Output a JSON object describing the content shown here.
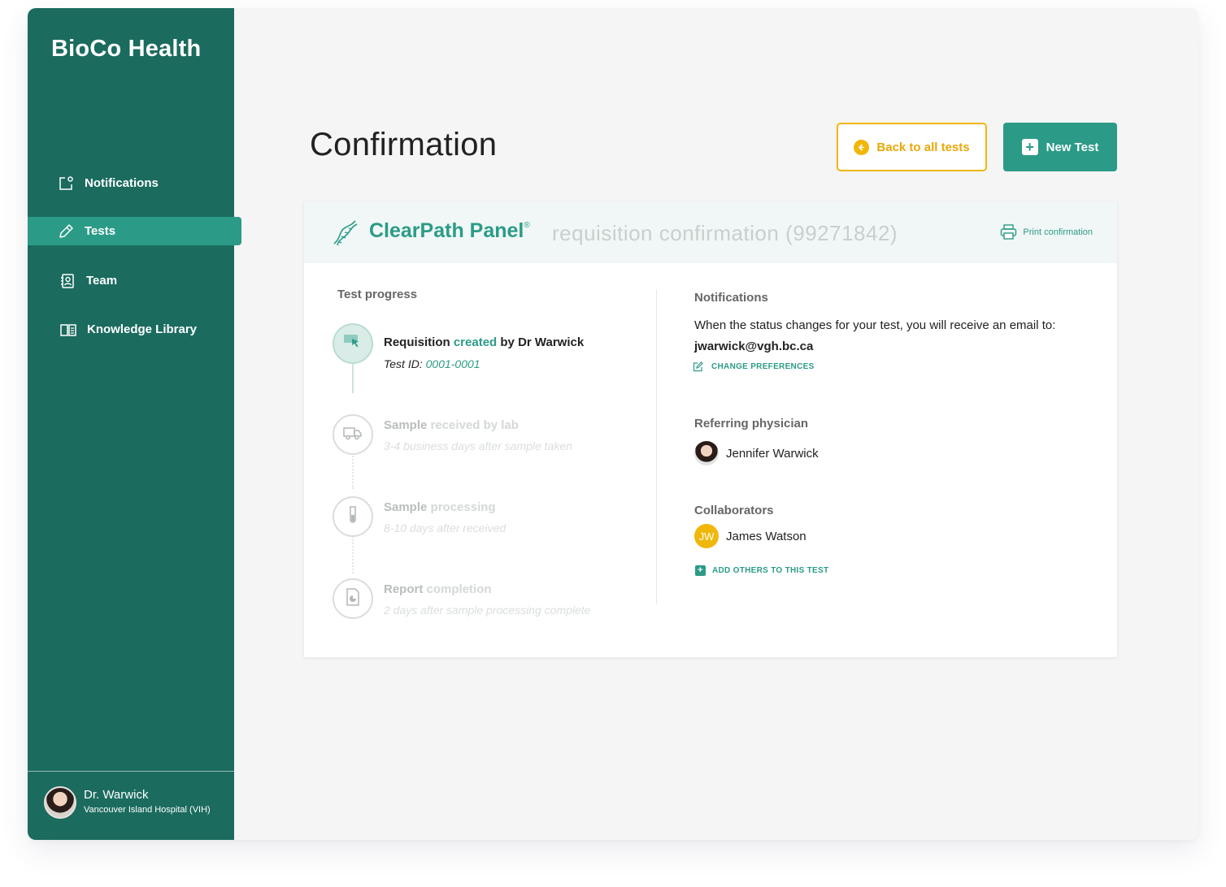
{
  "brand": "BioCo Health",
  "sidebar": {
    "items": [
      {
        "label": "Notifications",
        "icon": "notification-icon"
      },
      {
        "label": "Tests",
        "icon": "pencil-icon",
        "active": true
      },
      {
        "label": "Team",
        "icon": "contacts-icon"
      },
      {
        "label": "Knowledge Library",
        "icon": "book-icon"
      }
    ],
    "user": {
      "name": "Dr. Warwick",
      "hospital": "Vancouver Island Hospital (VIH)"
    }
  },
  "header": {
    "title": "Confirmation",
    "back_label": "Back to all tests",
    "new_label": "New Test"
  },
  "card": {
    "panel_name": "ClearPath Panel",
    "panel_mark": "®",
    "subtitle": "requisition confirmation (99271842)",
    "print_label": "Print confirmation",
    "progress": {
      "label": "Test progress",
      "steps": [
        {
          "lead": "Requisition",
          "accent": "created",
          "tail": "by Dr Warwick",
          "sub_lead": "Test ID: ",
          "sub_accent": "0001-0001",
          "icon": "cursor-icon",
          "state": "done"
        },
        {
          "lead": "Sample",
          "accent": "received by lab",
          "tail": "",
          "sub": "3-4 business days after sample taken",
          "icon": "truck-icon",
          "state": "pending"
        },
        {
          "lead": "Sample",
          "accent": "processing",
          "tail": "",
          "sub": "8-10 days after received",
          "icon": "test-tube-icon",
          "state": "pending"
        },
        {
          "lead": "Report",
          "accent": "completion",
          "tail": "",
          "sub": "2 days after sample processing complete",
          "icon": "report-icon",
          "state": "pending"
        }
      ]
    },
    "notifications": {
      "label": "Notifications",
      "text": "When the status changes for your test, you will receive an email to:",
      "email": "jwarwick@vgh.bc.ca",
      "change_label": "CHANGE PREFERENCES"
    },
    "referring": {
      "label": "Referring physician",
      "name": "Jennifer Warwick"
    },
    "collaborators": {
      "label": "Collaborators",
      "items": [
        {
          "initials": "JW",
          "name": "James Watson"
        }
      ],
      "add_label": "ADD OTHERS TO THIS TEST"
    }
  },
  "colors": {
    "primary": "#1b6b5f",
    "accent": "#2b9b87",
    "warning": "#f0b70a"
  }
}
